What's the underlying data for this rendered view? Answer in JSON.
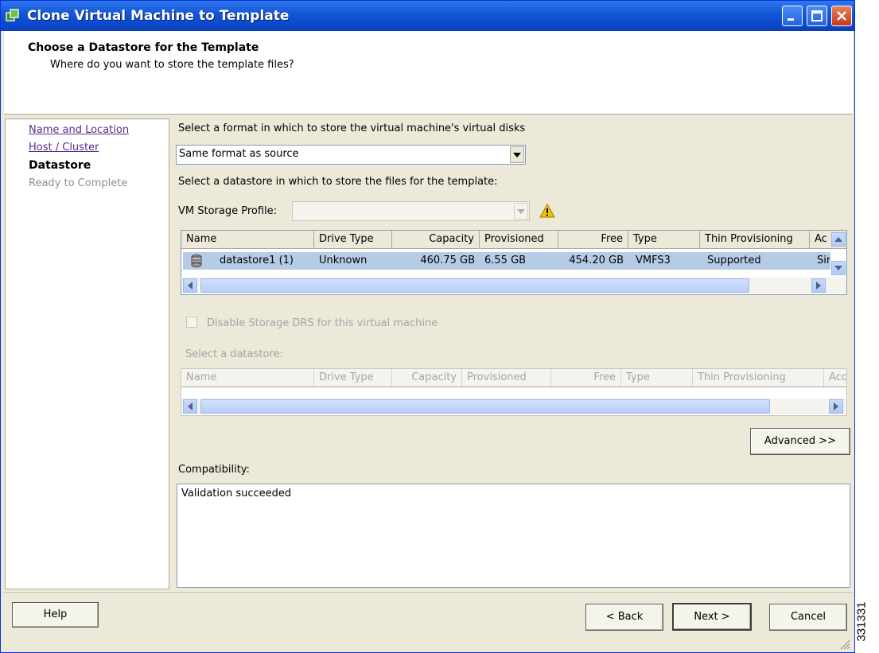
{
  "window": {
    "title": "Clone Virtual Machine to Template"
  },
  "header": {
    "title": "Choose a Datastore for the Template",
    "subtitle": "Where do you want to store the template files?"
  },
  "nav": {
    "items": [
      {
        "label": "Name and Location",
        "state": "link"
      },
      {
        "label": "Host / Cluster",
        "state": "link"
      },
      {
        "label": "Datastore",
        "state": "current"
      },
      {
        "label": "Ready to Complete",
        "state": "disabled"
      }
    ]
  },
  "format": {
    "prompt": "Select a format in which to store the virtual machine's virtual disks",
    "selected": "Same format as source"
  },
  "datastore": {
    "prompt": "Select a datastore in which to store the files for the template:",
    "profile_label": "VM Storage Profile:",
    "profile_value": "",
    "columns": [
      "Name",
      "Drive Type",
      "Capacity",
      "Provisioned",
      "Free",
      "Type",
      "Thin Provisioning",
      "Ac"
    ],
    "rows": [
      {
        "name": "datastore1 (1)",
        "drive_type": "Unknown",
        "capacity": "460.75 GB",
        "provisioned": "6.55 GB",
        "free": "454.20 GB",
        "type": "VMFS3",
        "thin": "Supported",
        "access": "Sir"
      }
    ]
  },
  "drs": {
    "checkbox_label": "Disable Storage DRS for this virtual machine",
    "select_label": "Select a datastore:",
    "columns": [
      "Name",
      "Drive Type",
      "Capacity",
      "Provisioned",
      "Free",
      "Type",
      "Thin Provisioning",
      "Acc"
    ]
  },
  "advanced_button": "Advanced >>",
  "compatibility": {
    "label": "Compatibility:",
    "text": "Validation succeeded"
  },
  "footer": {
    "help": "Help",
    "back": "< Back",
    "next": "Next >",
    "cancel": "Cancel"
  },
  "figure_id": "331331",
  "colors": {
    "titlebar": "#0a47c8",
    "dialog_bg": "#ece9d8",
    "row_selected": "#b6cce6",
    "link_visited": "#5a2a8a",
    "warning": "#f5c400"
  }
}
